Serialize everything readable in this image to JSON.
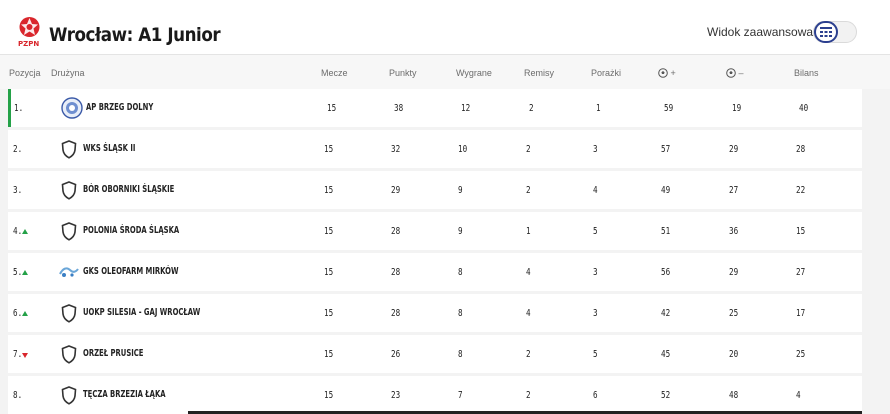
{
  "header": {
    "title": "Wrocław: A1 Junior",
    "logo_text": "PZPN",
    "advanced_view_label": "Widok zaawansowany",
    "accent_color": "#2b3f8f"
  },
  "columns": {
    "position": "Pozycja",
    "team": "Drużyna",
    "matches": "Mecze",
    "points": "Punkty",
    "wins": "Wygrane",
    "draws": "Remisy",
    "losses": "Porażki",
    "goals_for": "+",
    "goals_against": "–",
    "balance": "Bilans"
  },
  "rows": [
    {
      "pos": "1.",
      "trend": "none",
      "team": "AP Brzeg Dolny",
      "crest": "club-logo",
      "matches": "15",
      "points": "38",
      "wins": "12",
      "draws": "2",
      "losses": "1",
      "gf": "59",
      "ga": "19",
      "balance": "40"
    },
    {
      "pos": "2.",
      "trend": "none",
      "team": "WKS Śląsk II",
      "crest": "shield-icon",
      "matches": "15",
      "points": "32",
      "wins": "10",
      "draws": "2",
      "losses": "3",
      "gf": "57",
      "ga": "29",
      "balance": "28"
    },
    {
      "pos": "3.",
      "trend": "none",
      "team": "Bór Oborniki Śląskie",
      "crest": "shield-icon",
      "matches": "15",
      "points": "29",
      "wins": "9",
      "draws": "2",
      "losses": "4",
      "gf": "49",
      "ga": "27",
      "balance": "22"
    },
    {
      "pos": "4.",
      "trend": "up",
      "team": "Polonia Środa Śląska",
      "crest": "shield-icon",
      "matches": "15",
      "points": "28",
      "wins": "9",
      "draws": "1",
      "losses": "5",
      "gf": "51",
      "ga": "36",
      "balance": "15"
    },
    {
      "pos": "5.",
      "trend": "up",
      "team": "GKS Oleofarm Mirków",
      "crest": "club-logo",
      "matches": "15",
      "points": "28",
      "wins": "8",
      "draws": "4",
      "losses": "3",
      "gf": "56",
      "ga": "29",
      "balance": "27"
    },
    {
      "pos": "6.",
      "trend": "up",
      "team": "UOKP Silesia - Gaj Wrocław",
      "crest": "shield-icon",
      "matches": "15",
      "points": "28",
      "wins": "8",
      "draws": "4",
      "losses": "3",
      "gf": "42",
      "ga": "25",
      "balance": "17"
    },
    {
      "pos": "7.",
      "trend": "down",
      "team": "Orzeł Prusice",
      "crest": "shield-icon",
      "matches": "15",
      "points": "26",
      "wins": "8",
      "draws": "2",
      "losses": "5",
      "gf": "45",
      "ga": "20",
      "balance": "25"
    },
    {
      "pos": "8.",
      "trend": "none",
      "team": "Tęcza Brzezia Łąka",
      "crest": "shield-icon",
      "matches": "15",
      "points": "23",
      "wins": "7",
      "draws": "2",
      "losses": "6",
      "gf": "52",
      "ga": "48",
      "balance": "4"
    }
  ]
}
